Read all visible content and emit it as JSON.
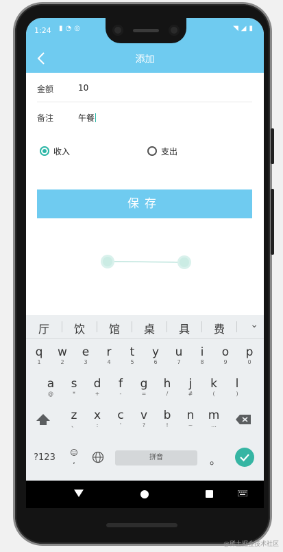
{
  "status_bar": {
    "time": "1:24",
    "left_icons": [
      "sd-card-icon",
      "wifi-icon",
      "at-sign-icon"
    ],
    "right_icons": [
      "wifi-icon",
      "signal-icon",
      "battery-icon"
    ]
  },
  "header": {
    "title": "添加",
    "back_icon": "chevron-left-icon"
  },
  "form": {
    "amount_label": "金额",
    "amount_value": "10",
    "note_label": "备注",
    "note_value": "午餐"
  },
  "type_options": [
    {
      "label": "收入",
      "checked": true
    },
    {
      "label": "支出",
      "checked": false
    }
  ],
  "save_button": "保存",
  "keyboard": {
    "candidates": [
      "厅",
      "饮",
      "馆",
      "桌",
      "具",
      "费"
    ],
    "row1": [
      {
        "main": "q",
        "sub": "1"
      },
      {
        "main": "w",
        "sub": "2"
      },
      {
        "main": "e",
        "sub": "3"
      },
      {
        "main": "r",
        "sub": "4"
      },
      {
        "main": "t",
        "sub": "5"
      },
      {
        "main": "y",
        "sub": "6"
      },
      {
        "main": "u",
        "sub": "7"
      },
      {
        "main": "i",
        "sub": "8"
      },
      {
        "main": "o",
        "sub": "9"
      },
      {
        "main": "p",
        "sub": "0"
      }
    ],
    "row2": [
      {
        "main": "a",
        "sub": "@"
      },
      {
        "main": "s",
        "sub": "*"
      },
      {
        "main": "d",
        "sub": "+"
      },
      {
        "main": "f",
        "sub": "-"
      },
      {
        "main": "g",
        "sub": "="
      },
      {
        "main": "h",
        "sub": "/"
      },
      {
        "main": "j",
        "sub": "#"
      },
      {
        "main": "k",
        "sub": "("
      },
      {
        "main": "l",
        "sub": ")"
      }
    ],
    "row3": [
      {
        "main": "z",
        "sub": "、"
      },
      {
        "main": "x",
        "sub": ":"
      },
      {
        "main": "c",
        "sub": "'"
      },
      {
        "main": "v",
        "sub": "?"
      },
      {
        "main": "b",
        "sub": "!"
      },
      {
        "main": "n",
        "sub": "~"
      },
      {
        "main": "m",
        "sub": "…"
      }
    ],
    "symbols_key": "?123",
    "space_label": "拼音",
    "period_key": "。"
  },
  "watermark": "@稀土掘金技术社区",
  "colors": {
    "brand": "#6fcbf0",
    "accent": "#2bb6a6",
    "enter": "#36b5a3"
  }
}
